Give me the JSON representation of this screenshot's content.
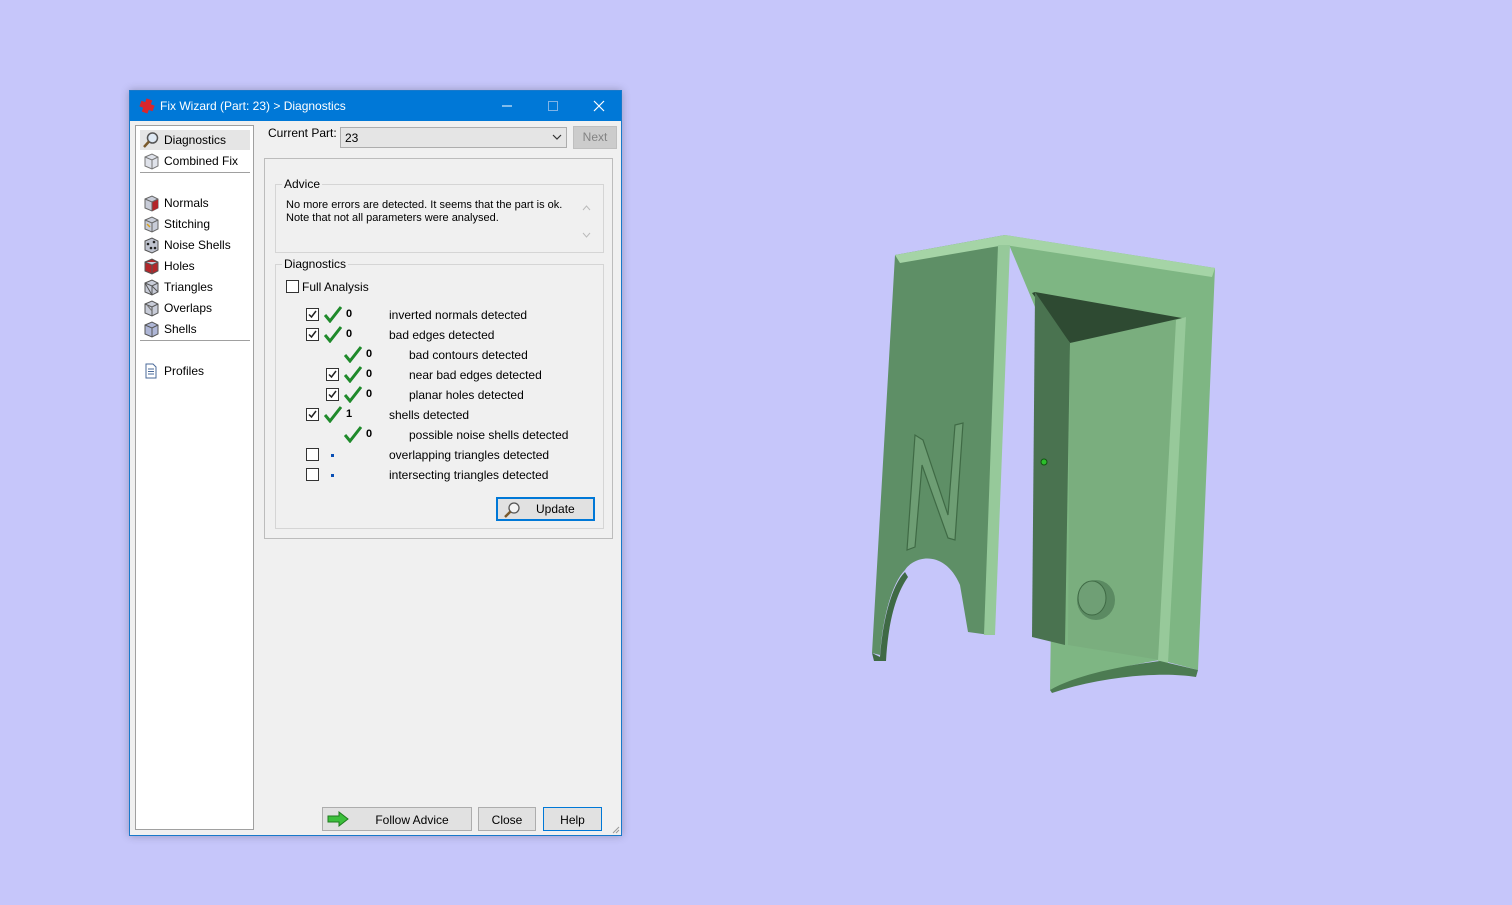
{
  "window": {
    "title": "Fix Wizard (Part: 23) > Diagnostics"
  },
  "sidebar": {
    "items": [
      {
        "label": "Diagnostics",
        "icon": "magnifier-icon"
      },
      {
        "label": "Combined Fix",
        "icon": "cube-icon"
      },
      {
        "label": "Normals",
        "icon": "normals-cube-icon"
      },
      {
        "label": "Stitching",
        "icon": "stitching-cube-icon"
      },
      {
        "label": "Noise Shells",
        "icon": "noise-shells-icon"
      },
      {
        "label": "Holes",
        "icon": "holes-cube-icon"
      },
      {
        "label": "Triangles",
        "icon": "triangles-cube-icon"
      },
      {
        "label": "Overlaps",
        "icon": "overlaps-cube-icon"
      },
      {
        "label": "Shells",
        "icon": "shells-cube-icon"
      },
      {
        "label": "Profiles",
        "icon": "document-icon"
      }
    ],
    "selected": "Diagnostics"
  },
  "current_part": {
    "label": "Current Part:",
    "value": "23",
    "next_label": "Next"
  },
  "advice": {
    "title": "Advice",
    "line1": "No more errors are detected. It seems that the part is ok.",
    "line2": "Note that not all parameters were analysed."
  },
  "diagnostics": {
    "title": "Diagnostics",
    "full_analysis_label": "Full Analysis",
    "full_analysis_checked": false,
    "rows": [
      {
        "checked": true,
        "status": "ok",
        "count": "0",
        "label": "inverted normals detected"
      },
      {
        "checked": true,
        "status": "ok",
        "count": "0",
        "label": "bad edges detected"
      },
      {
        "checked": null,
        "status": "ok",
        "count": "0",
        "label": "bad contours detected"
      },
      {
        "checked": true,
        "status": "ok",
        "count": "0",
        "label": "near bad edges detected"
      },
      {
        "checked": true,
        "status": "ok",
        "count": "0",
        "label": "planar holes detected"
      },
      {
        "checked": true,
        "status": "ok",
        "count": "1",
        "label": "shells detected"
      },
      {
        "checked": null,
        "status": "ok",
        "count": "0",
        "label": "possible noise shells detected"
      },
      {
        "checked": false,
        "status": "not-analysed",
        "count": "",
        "label": "overlapping triangles detected"
      },
      {
        "checked": false,
        "status": "not-analysed",
        "count": "",
        "label": "intersecting triangles detected"
      }
    ],
    "update_label": "Update"
  },
  "footer": {
    "follow_advice_label": "Follow Advice",
    "close_label": "Close",
    "help_label": "Help"
  },
  "viewport": {
    "background_color": "#c6c6fa",
    "model_color": "#7fb883",
    "model_letter": "N"
  }
}
